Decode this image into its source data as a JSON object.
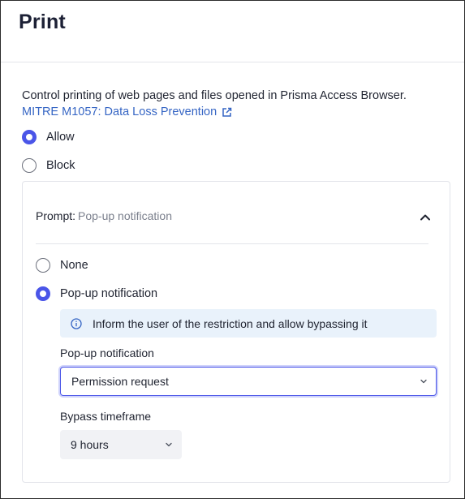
{
  "header": {
    "title": "Print"
  },
  "description": "Control printing of web pages and files opened in Prisma Access Browser.",
  "reference_link": {
    "label": "MITRE M1057: Data Loss Prevention",
    "icon": "external-link-icon"
  },
  "action_options": [
    {
      "label": "Allow",
      "selected": true
    },
    {
      "label": "Block",
      "selected": false
    }
  ],
  "prompt": {
    "label": "Prompt:",
    "value": "Pop-up notification",
    "expanded": true,
    "options": [
      {
        "label": "None",
        "selected": false
      },
      {
        "label": "Pop-up notification",
        "selected": true
      }
    ],
    "info_text": "Inform the user of the restriction and allow bypassing it",
    "popup_field": {
      "label": "Pop-up notification",
      "value": "Permission request"
    },
    "bypass_field": {
      "label": "Bypass timeframe",
      "value": "9 hours"
    }
  },
  "colors": {
    "accent": "#4a55e8",
    "link": "#3565c4",
    "info_bg": "#e9f2fb"
  }
}
